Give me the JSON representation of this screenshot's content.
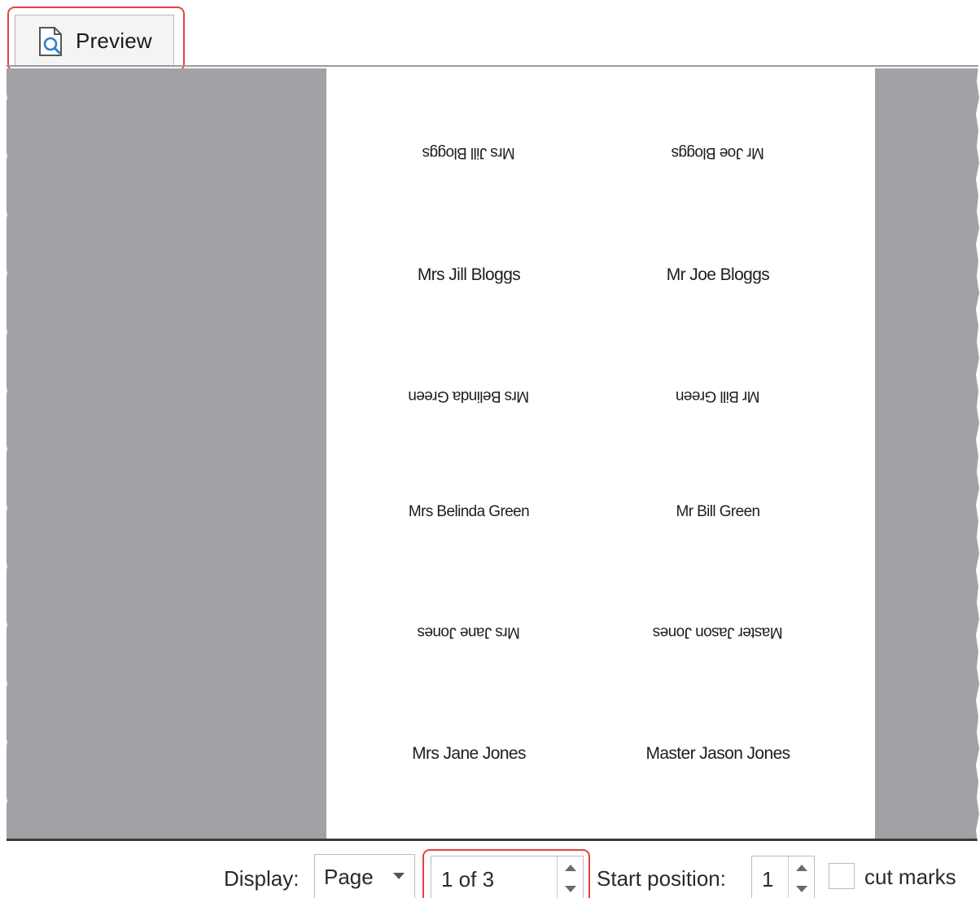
{
  "tab": {
    "label": "Preview",
    "icon": "document-magnifier-icon"
  },
  "labels": [
    {
      "text": "Mrs Jill Bloggs",
      "flipped": true
    },
    {
      "text": "Mr Joe Bloggs",
      "flipped": true
    },
    {
      "text": "Mrs Jill Bloggs",
      "flipped": false
    },
    {
      "text": "Mr Joe Bloggs",
      "flipped": false
    },
    {
      "text": "Mrs Belinda Green",
      "flipped": true
    },
    {
      "text": "Mr Bill Green",
      "flipped": true
    },
    {
      "text": "Mrs Belinda Green",
      "flipped": false
    },
    {
      "text": "Mr Bill Green",
      "flipped": false
    },
    {
      "text": "Mrs Jane Jones",
      "flipped": true
    },
    {
      "text": "Master Jason Jones",
      "flipped": true
    },
    {
      "text": "Mrs Jane Jones",
      "flipped": false
    },
    {
      "text": "Master Jason Jones",
      "flipped": false
    }
  ],
  "toolbar": {
    "display_label": "Display:",
    "display_value": "Page",
    "page_value": "1 of 3",
    "start_position_label": "Start position:",
    "start_position_value": "1",
    "cut_marks_label": "cut marks",
    "cut_marks_checked": false
  },
  "colors": {
    "highlight": "#e2453f",
    "preview_background": "#a2a1a6",
    "page": "#ffffff",
    "icon_accent": "#2f7fd0"
  }
}
